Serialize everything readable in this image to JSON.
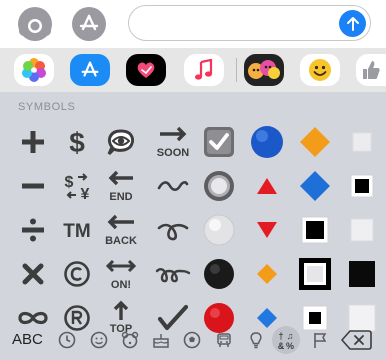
{
  "keyboard": {
    "section_label": "SYMBOLS",
    "abc_label": "ABC"
  },
  "symbols": [
    {
      "text": "SOON"
    },
    {
      "text": "END"
    },
    {
      "text": "BACK"
    },
    {
      "text": "ON!"
    },
    {
      "text": "TOP"
    },
    {
      "text": "TM"
    }
  ],
  "colors": {
    "send_blue": "#1a82f6",
    "gray_icon": "#9a9aa0",
    "keyboard_bg": "#d2d5db",
    "app_bar_bg": "#e6e6e6"
  }
}
